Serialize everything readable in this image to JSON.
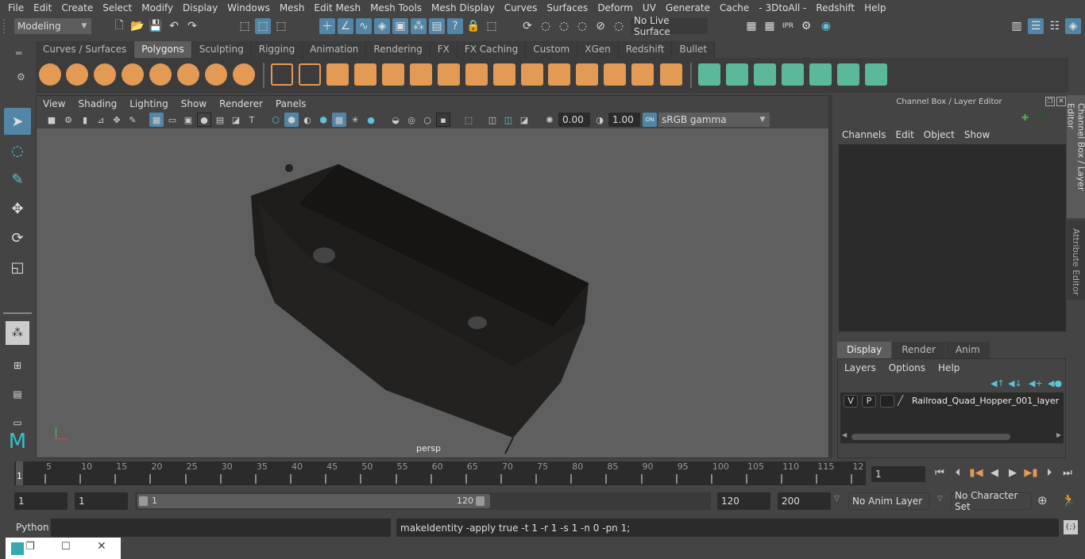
{
  "menubar": [
    "File",
    "Edit",
    "Create",
    "Select",
    "Modify",
    "Display",
    "Windows",
    "Mesh",
    "Edit Mesh",
    "Mesh Tools",
    "Mesh Display",
    "Curves",
    "Surfaces",
    "Deform",
    "UV",
    "Generate",
    "Cache",
    "- 3DtoAll -",
    "Redshift",
    "Help"
  ],
  "status_line": {
    "mode": "Modeling",
    "live_surface": "No Live Surface"
  },
  "shelf": {
    "tabs": [
      "Curves / Surfaces",
      "Polygons",
      "Sculpting",
      "Rigging",
      "Animation",
      "Rendering",
      "FX",
      "FX Caching",
      "Custom",
      "XGen",
      "Redshift",
      "Bullet"
    ],
    "active_tab": "Polygons",
    "tool_icons": [
      "poly-sphere-icon",
      "poly-cube-icon",
      "poly-cylinder-icon",
      "poly-cone-icon",
      "poly-plane-icon",
      "poly-torus-icon",
      "poly-pyramid-icon",
      "poly-pipe-icon",
      "combine-icon",
      "separate-icon",
      "mirror-icon",
      "smooth-icon",
      "bevel-icon",
      "extrude-icon",
      "bridge-icon",
      "multi-cut-icon",
      "target-weld-icon",
      "append-polygon-icon",
      "fill-hole-icon",
      "edge-loop-icon",
      "insert-edge-loop-icon",
      "offset-edge-loop-icon",
      "merge-icon",
      "collapse-icon",
      "planar-uv-icon",
      "cylindrical-uv-icon",
      "spherical-uv-icon",
      "automatic-uv-icon",
      "unfold-uv-icon",
      "uv-editor-icon",
      "layout-uv-icon"
    ]
  },
  "viewport": {
    "menu": [
      "View",
      "Shading",
      "Lighting",
      "Show",
      "Renderer",
      "Panels"
    ],
    "exposure": "0.00",
    "gamma": "1.00",
    "color_management": "ON",
    "color_space": "sRGB gamma",
    "camera_label": "persp"
  },
  "channel_box": {
    "title": "Channel Box / Layer Editor",
    "menu": [
      "Channels",
      "Edit",
      "Object",
      "Show"
    ]
  },
  "layer_editor": {
    "tabs": [
      "Display",
      "Render",
      "Anim"
    ],
    "active_tab": "Display",
    "menu": [
      "Layers",
      "Options",
      "Help"
    ],
    "layers": [
      {
        "visible": "V",
        "playback": "P",
        "name": "Railroad_Quad_Hopper_001_layer"
      }
    ]
  },
  "side_tabs": [
    "Channel Box / Layer Editor",
    "Attribute Editor"
  ],
  "timeline": {
    "ticks": [
      "5",
      "10",
      "15",
      "20",
      "25",
      "30",
      "35",
      "40",
      "45",
      "50",
      "55",
      "60",
      "65",
      "70",
      "75",
      "80",
      "85",
      "90",
      "95",
      "100",
      "105",
      "110",
      "115",
      "12"
    ],
    "current_frame_marker": "1",
    "current_frame": "1"
  },
  "range": {
    "start": "1",
    "playback_start": "1",
    "slider_start": "1",
    "slider_end": "120",
    "playback_end": "120",
    "end": "200",
    "anim_layer": "No Anim Layer",
    "character_set": "No Character Set"
  },
  "command_line": {
    "language": "Python",
    "input": "",
    "last_output": "makeIdentity -apply true -t 1 -r 1 -s 1 -n 0 -pn 1;"
  }
}
